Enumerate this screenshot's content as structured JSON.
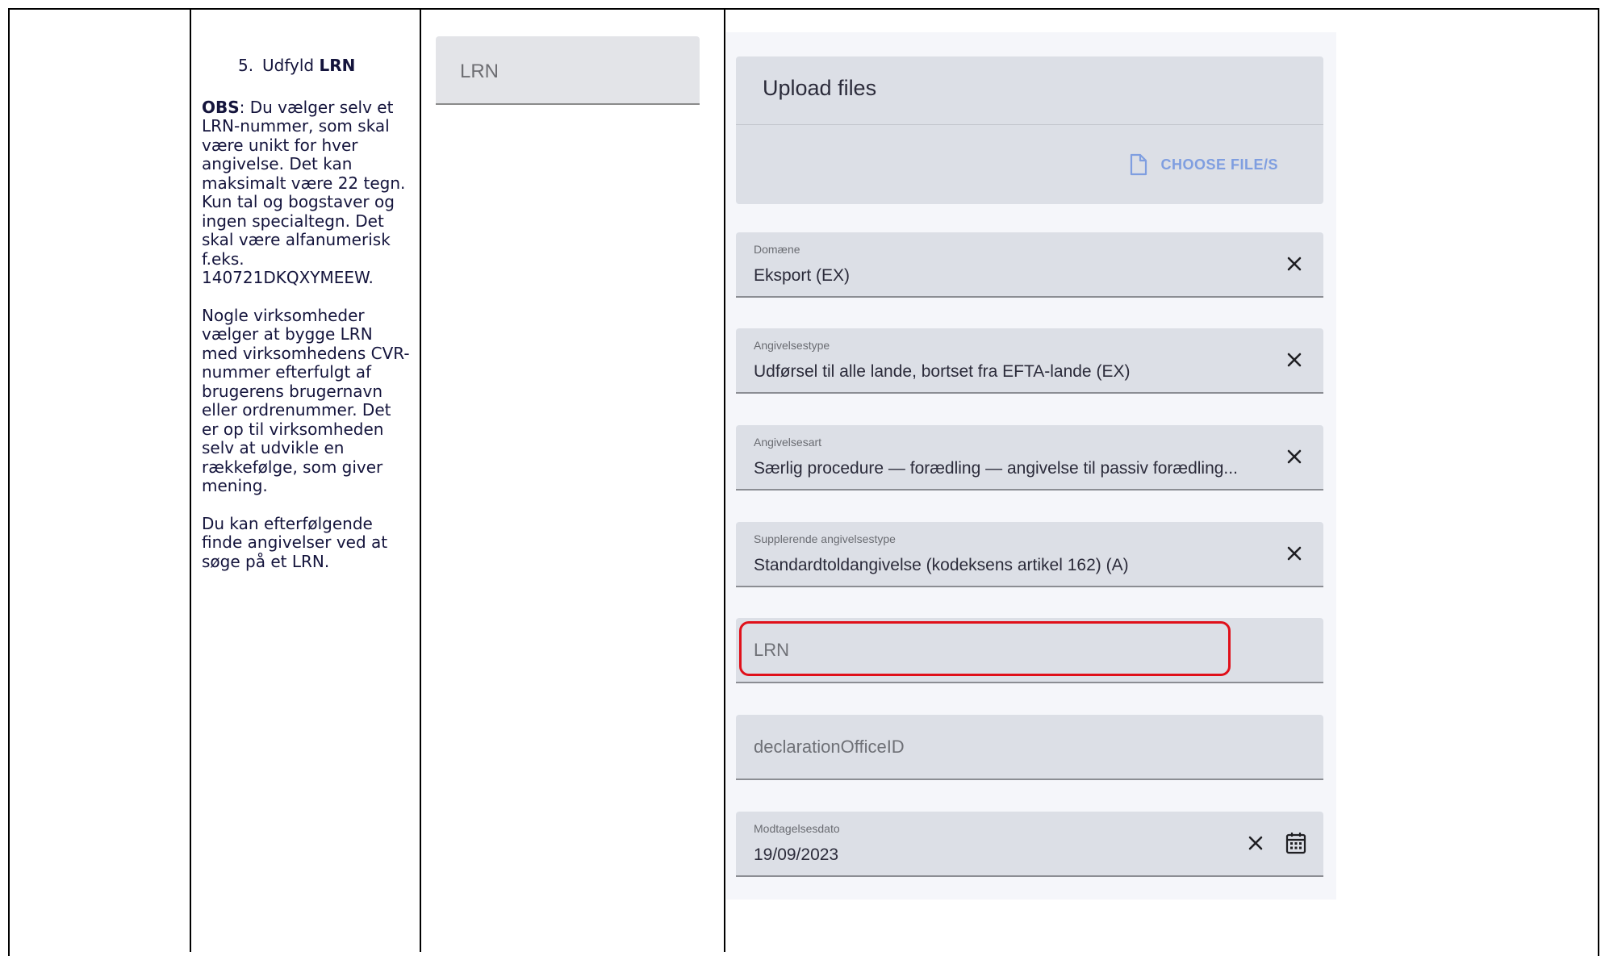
{
  "instructions": {
    "step_number": "5.",
    "step_text": "Udfyld ",
    "step_bold": "LRN",
    "obs_label": "OBS",
    "obs_text": ": Du vælger selv et LRN-nummer, som skal være unikt for hver angivelse. Det kan maksimalt være 22 tegn. Kun tal og bogstaver og ingen specialtegn. Det skal være alfanumerisk f.eks. 140721DKQXYMEEW.",
    "paragraph2": "Nogle virksomheder vælger at bygge LRN med virksomhedens CVR-nummer efterfulgt af brugerens brugernavn eller ordrenummer. Det er op til virksomheden selv at udvikle en rækkefølge, som giver mening.",
    "paragraph3": "Du kan efterfølgende finde angivelser ved at søge på et LRN."
  },
  "field_preview": {
    "placeholder": "LRN"
  },
  "form": {
    "upload_title": "Upload files",
    "choose_files_label": "CHOOSE FILE/S",
    "domaene": {
      "label": "Domæne",
      "value": "Eksport (EX)"
    },
    "angivelsestype": {
      "label": "Angivelsestype",
      "value": "Udførsel til alle lande, bortset fra EFTA-lande (EX)"
    },
    "angivelsesart": {
      "label": "Angivelsesart",
      "value": "Særlig procedure — forædling — angivelse til passiv forædling..."
    },
    "supplerende": {
      "label": "Supplerende angivelsestype",
      "value": "Standardtoldangivelse (kodeksens artikel 162) (A)"
    },
    "lrn": {
      "placeholder": "LRN"
    },
    "office": {
      "placeholder": "declarationOfficeID"
    },
    "modtagelsesdato": {
      "label": "Modtagelsesdato",
      "value": "19/09/2023"
    }
  },
  "colors": {
    "highlight": "#e0101a",
    "link": "#7f9ee0",
    "field_bg": "#dcdfe6"
  }
}
